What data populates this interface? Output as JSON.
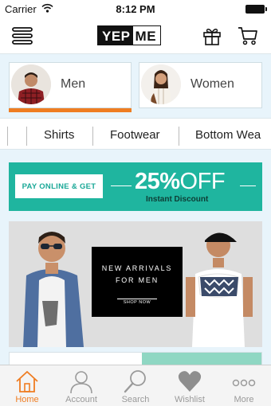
{
  "status_bar": {
    "carrier": "Carrier",
    "time": "8:12 PM"
  },
  "header": {
    "logo_part1": "YEP",
    "logo_part2": "ME"
  },
  "gender_tabs": [
    {
      "label": "Men",
      "selected": true
    },
    {
      "label": "Women",
      "selected": false
    }
  ],
  "categories": [
    "Shirts",
    "Footwear",
    "Bottom Wea"
  ],
  "offer_banner": {
    "pay_text": "PAY ONLINE & GET",
    "discount_value": "25%",
    "discount_word": "OFF",
    "subtitle": "Instant Discount"
  },
  "arrivals_banner": {
    "line1": "NEW ARRIVALS",
    "line2": "FOR MEN",
    "cta": "SHOP NOW"
  },
  "tab_bar": [
    {
      "label": "Home",
      "icon": "home-icon",
      "active": true
    },
    {
      "label": "Account",
      "icon": "user-icon",
      "active": false
    },
    {
      "label": "Search",
      "icon": "search-icon",
      "active": false
    },
    {
      "label": "Wishlist",
      "icon": "heart-icon",
      "active": false
    },
    {
      "label": "More",
      "icon": "more-icon",
      "active": false
    }
  ],
  "colors": {
    "accent": "#ef7d22",
    "offer_green": "#1fb59f",
    "content_bg": "#e8f4fb",
    "inactive_tab": "#9a9a9a"
  }
}
